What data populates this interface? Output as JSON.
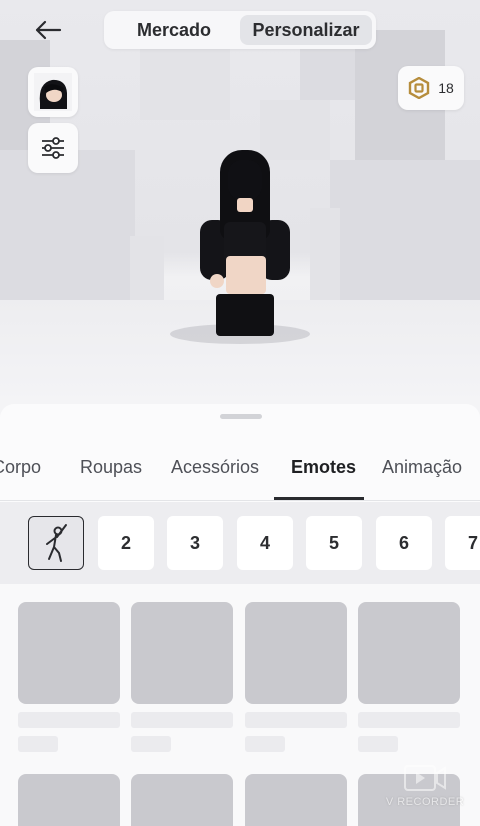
{
  "header": {
    "segments": [
      {
        "label": "Mercado",
        "active": false
      },
      {
        "label": "Personalizar",
        "active": true
      }
    ],
    "robux_count": "18"
  },
  "icons": {
    "back": "arrow-left-icon",
    "avatar_thumb": "avatar-headshot-icon",
    "filters": "sliders-icon",
    "robux": "robux-icon",
    "emote_slot": "dance-emote-icon",
    "recorder": "video-recorder-icon"
  },
  "categories": [
    {
      "label": "Corpo",
      "active": false
    },
    {
      "label": "Roupas",
      "active": false
    },
    {
      "label": "Acessórios",
      "active": false
    },
    {
      "label": "Emotes",
      "active": true
    },
    {
      "label": "Animação",
      "active": false
    }
  ],
  "emote_slots": [
    "2",
    "3",
    "4",
    "5",
    "6",
    "7"
  ],
  "watermark": "V RECORDER",
  "colors": {
    "accent": "#2a2b2f",
    "skeleton_card": "#c9c9ce",
    "skeleton_bar": "#ebebee",
    "robux_gold": "#b68d3c"
  }
}
